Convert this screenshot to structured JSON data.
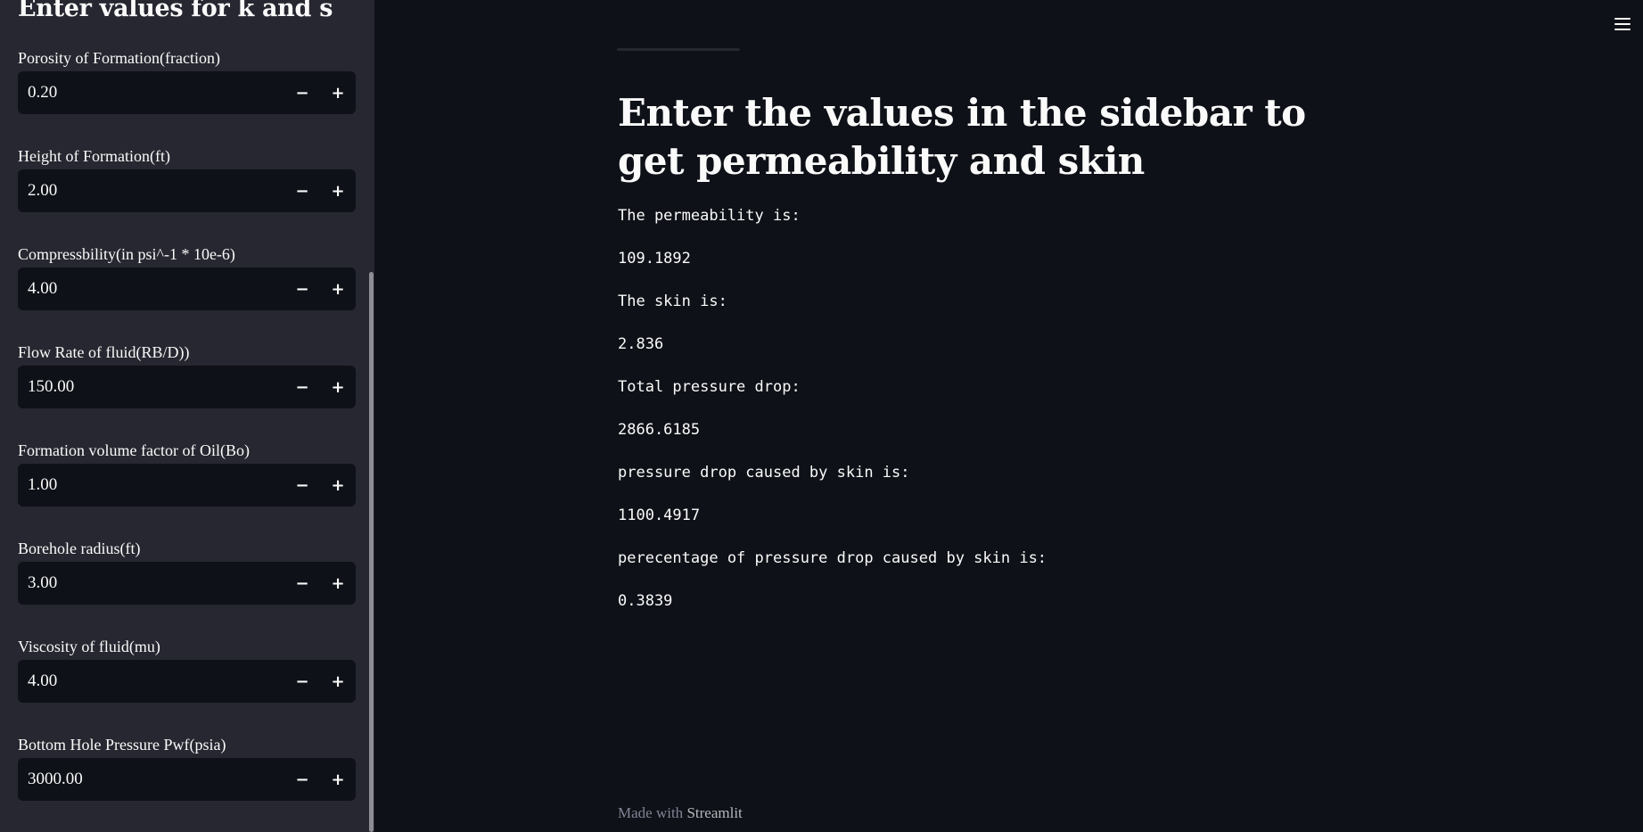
{
  "sidebar": {
    "title": "Enter values for k and s",
    "fields": [
      {
        "label": "Porosity of Formation(fraction)",
        "value": "0.20"
      },
      {
        "label": "Height of Formation(ft)",
        "value": "2.00"
      },
      {
        "label": "Compressbility(in psi^-1 * 10e-6)",
        "value": "4.00"
      },
      {
        "label": "Flow Rate of fluid(RB/D))",
        "value": "150.00"
      },
      {
        "label": "Formation volume factor of Oil(Bo)",
        "value": "1.00"
      },
      {
        "label": "Borehole radius(ft)",
        "value": "3.00"
      },
      {
        "label": "Viscosity of fluid(mu)",
        "value": "4.00"
      },
      {
        "label": "Bottom Hole Pressure Pwf(psia)",
        "value": "3000.00"
      }
    ],
    "minus_symbol": "−",
    "plus_symbol": "+"
  },
  "main": {
    "title": "Enter the values in the sidebar to get permeability and skin",
    "results": [
      "The permeability is:",
      "109.1892",
      "The skin is:",
      "2.836",
      "Total pressure drop:",
      "2866.6185",
      "pressure drop caused by skin is:",
      "1100.4917",
      "perecentage of pressure drop caused by skin is:",
      "0.3839"
    ]
  },
  "footer": {
    "prefix": "Made with ",
    "brand": "Streamlit"
  },
  "icons": {
    "menu": "hamburger-menu-icon"
  },
  "colors": {
    "background": "#0e1117",
    "sidebar": "#262730",
    "text": "#fafafa"
  }
}
